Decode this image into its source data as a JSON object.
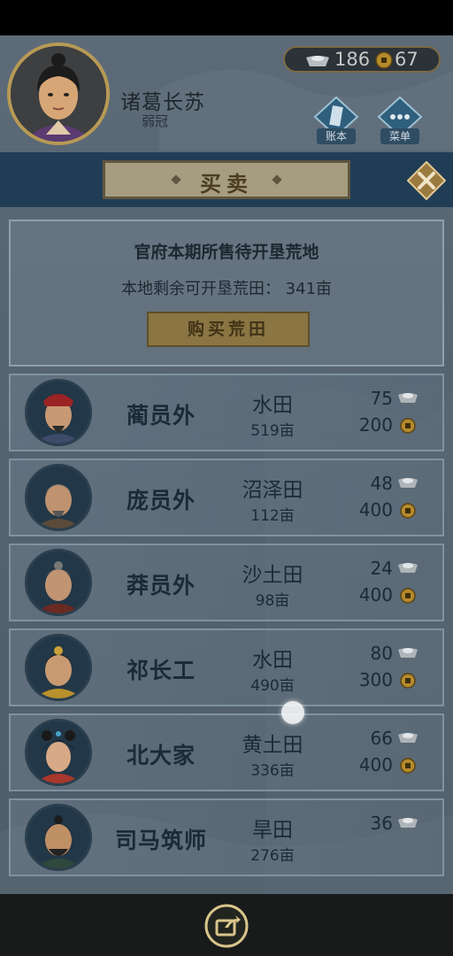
{
  "player": {
    "name": "诸葛长苏",
    "title": "弱冠"
  },
  "currency": {
    "silver": "186",
    "copper": "67"
  },
  "header_buttons": {
    "ledger": "账本",
    "menu": "菜单"
  },
  "banner": {
    "title": "买卖"
  },
  "info": {
    "title": "官府本期所售待开垦荒地",
    "remaining": "本地剩余可开垦荒田：  341亩",
    "buy_button": "购买荒田"
  },
  "sellers": [
    {
      "name": "蔺员外",
      "land_type": "水田",
      "land_size": "519亩",
      "silver": "75",
      "copper": "200"
    },
    {
      "name": "庞员外",
      "land_type": "沼泽田",
      "land_size": "112亩",
      "silver": "48",
      "copper": "400"
    },
    {
      "name": "莽员外",
      "land_type": "沙土田",
      "land_size": "98亩",
      "silver": "24",
      "copper": "400"
    },
    {
      "name": "祁长工",
      "land_type": "水田",
      "land_size": "490亩",
      "silver": "80",
      "copper": "300"
    },
    {
      "name": "北大家",
      "land_type": "黄土田",
      "land_size": "336亩",
      "silver": "66",
      "copper": "400"
    },
    {
      "name": "司马筑师",
      "land_type": "旱田",
      "land_size": "276亩",
      "silver": "36",
      "copper": ""
    }
  ]
}
